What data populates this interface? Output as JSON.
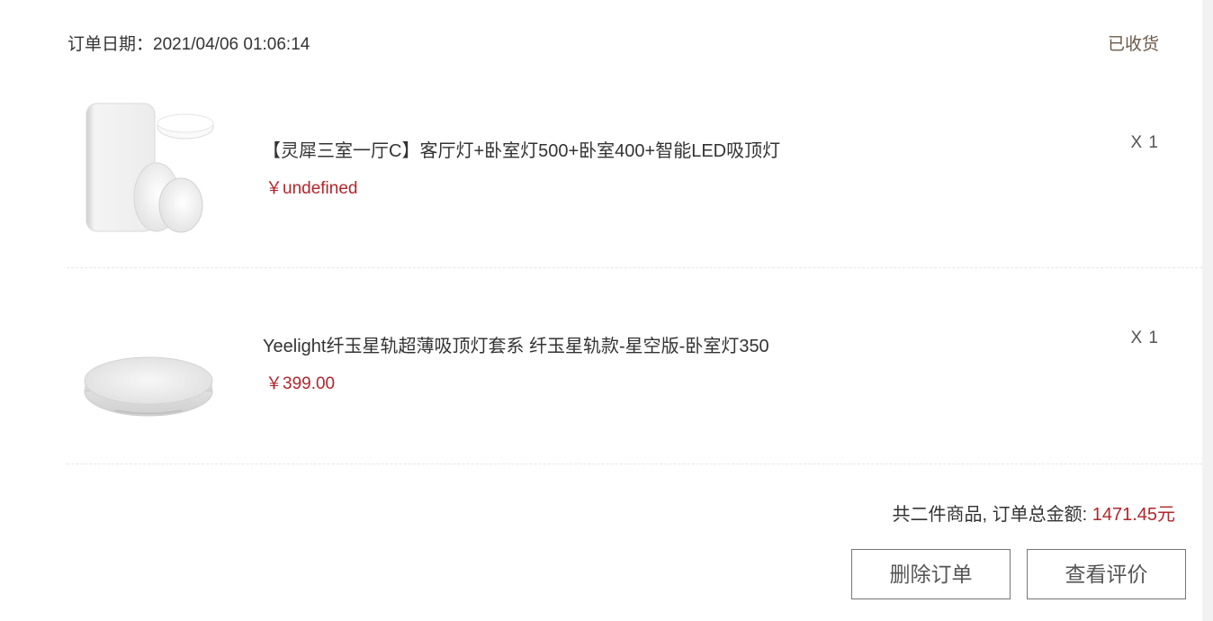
{
  "order": {
    "date_text": "订单日期：2021/04/06 01:06:14",
    "status": "已收货"
  },
  "items": [
    {
      "name": "【灵犀三室一厅C】客厅灯+卧室灯500+卧室400+智能LED吸顶灯",
      "price": "￥undefined",
      "quantity": "X 1",
      "image_icon": "ceiling-light-set-image"
    },
    {
      "name": "Yeelight纤玉星轨超薄吸顶灯套系 纤玉星轨款-星空版-卧室灯350",
      "price": "￥399.00",
      "quantity": "X 1",
      "image_icon": "round-ceiling-light-image"
    }
  ],
  "summary": {
    "label": "共二件商品, 订单总金额: ",
    "total": "1471.45元"
  },
  "actions": {
    "delete_label": "删除订单",
    "review_label": "查看评价"
  },
  "colors": {
    "price_red": "#b0262c",
    "status_brown": "#6b5a4a",
    "border_gray": "#767676"
  }
}
